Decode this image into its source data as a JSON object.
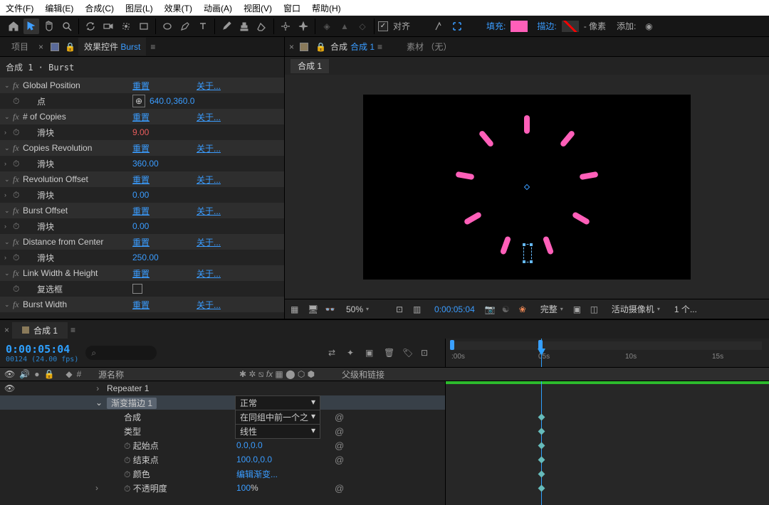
{
  "menu": {
    "file": "文件(F)",
    "edit": "编辑(E)",
    "comp": "合成(C)",
    "layer": "图层(L)",
    "effect": "效果(T)",
    "anim": "动画(A)",
    "view": "视图(V)",
    "window": "窗口",
    "help": "帮助(H)"
  },
  "toolbar": {
    "align": "对齐",
    "fill": "填充:",
    "stroke": "描边:",
    "px": "- 像素",
    "add": "添加:",
    "fill_color": "#ff5fb9"
  },
  "panels": {
    "project": "项目",
    "fxctl": "效果控件",
    "fxname": "Burst",
    "comp": "合成",
    "compname": "合成 1",
    "footage": "素材",
    "none": "（无）"
  },
  "crumb": "合成 1 · Burst",
  "fx": [
    {
      "name": "Global Position",
      "reset": "重置",
      "about": "关于...",
      "sub": {
        "label": "点",
        "val": "640.0,360.0",
        "point": true
      }
    },
    {
      "name": "# of Copies",
      "reset": "重置",
      "about": "关于...",
      "sub": {
        "label": "滑块",
        "val": "9.00",
        "hot": true
      }
    },
    {
      "name": "Copies Revolution",
      "reset": "重置",
      "about": "关于...",
      "sub": {
        "label": "滑块",
        "val": "360.00"
      }
    },
    {
      "name": "Revolution Offset",
      "reset": "重置",
      "about": "关于...",
      "sub": {
        "label": "滑块",
        "val": "0.00"
      }
    },
    {
      "name": "Burst Offset",
      "reset": "重置",
      "about": "关于...",
      "sub": {
        "label": "滑块",
        "val": "0.00"
      }
    },
    {
      "name": "Distance from Center",
      "reset": "重置",
      "about": "关于...",
      "sub": {
        "label": "滑块",
        "val": "250.00"
      }
    },
    {
      "name": "Link Width & Height",
      "reset": "重置",
      "about": "关于...",
      "sub": {
        "label": "复选框",
        "checkbox": true
      }
    },
    {
      "name": "Burst Width",
      "reset": "重置",
      "about": "关于..."
    }
  ],
  "comp_tab": "合成 1",
  "viewer": {
    "zoom": "50%",
    "time": "0:00:05:04",
    "res": "完整",
    "cam": "活动摄像机",
    "views": "1 个..."
  },
  "timeline": {
    "tab": "合成 1",
    "timecode": "0:00:05:04",
    "frames": "00124 (24.00 fps)",
    "src_col": "源名称",
    "parent_col": "父级和链接",
    "ticks": {
      "t0": ":00s",
      "t1": "05s",
      "t2": "10s",
      "t3": "15s"
    },
    "rows": {
      "repeater": "Repeater 1",
      "grad": {
        "name": "渐变描边 1",
        "mode": "正常"
      },
      "compose": {
        "name": "合成",
        "mode": "在同组中前一个之"
      },
      "type": {
        "name": "类型",
        "mode": "线性"
      },
      "start": {
        "name": "起始点",
        "val": "0.0,0.0"
      },
      "end": {
        "name": "结束点",
        "val": "100.0,0.0"
      },
      "color": {
        "name": "颜色",
        "val": "编辑渐变..."
      },
      "opacity": {
        "name": "不透明度",
        "val": "100",
        "pct": "%"
      }
    }
  }
}
